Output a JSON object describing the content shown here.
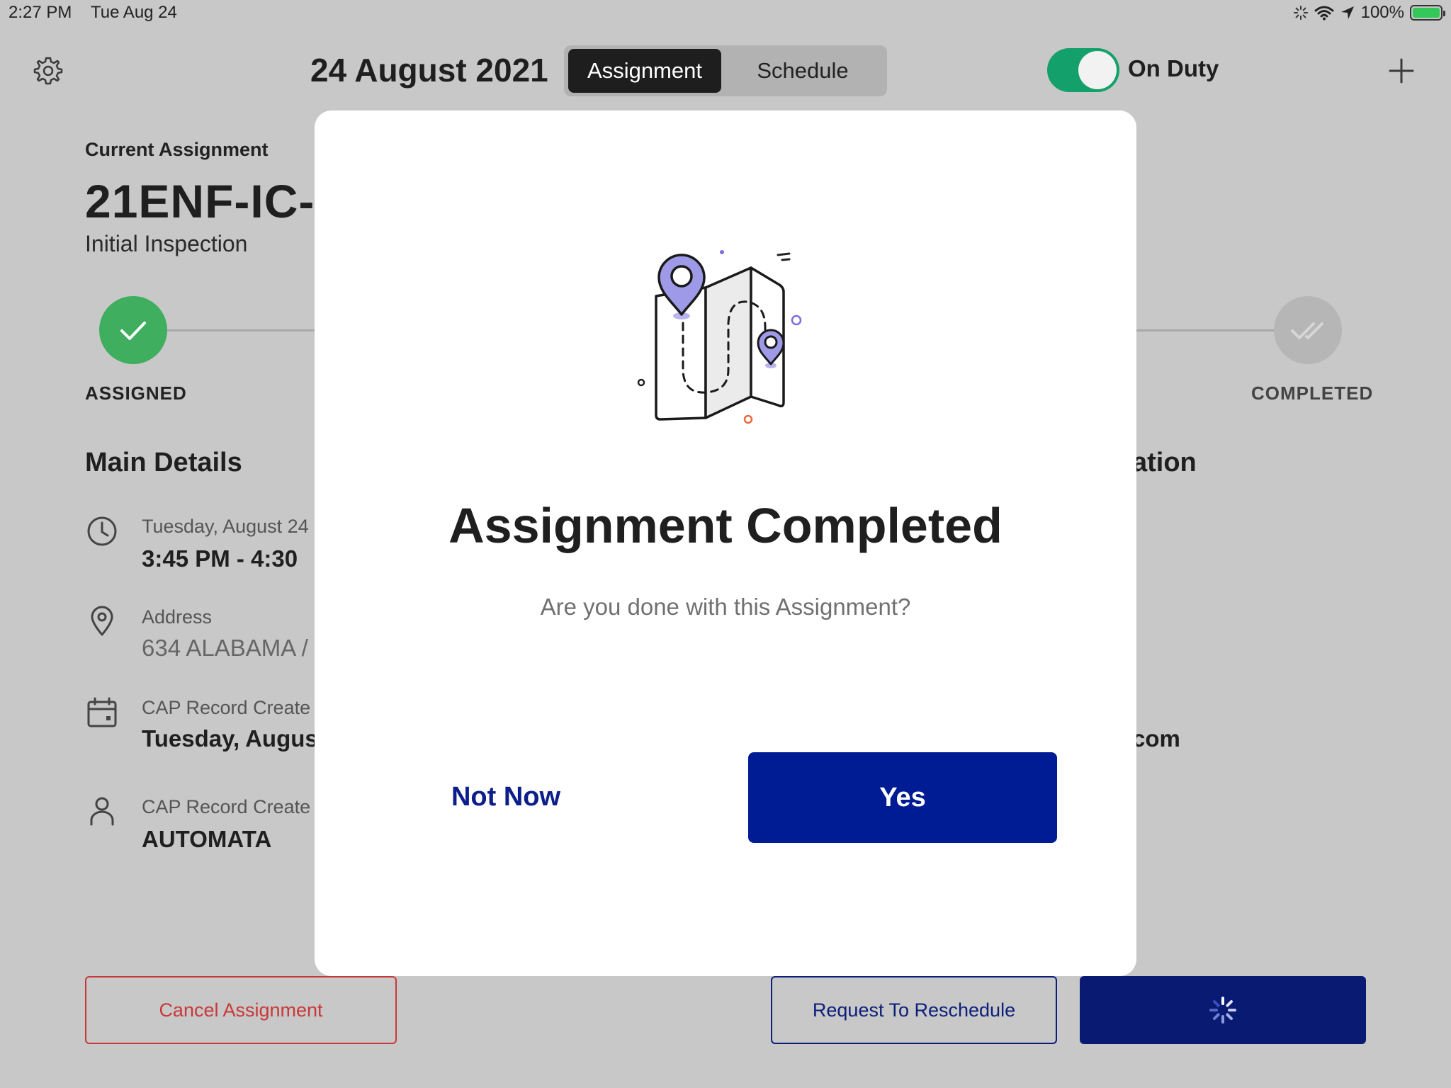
{
  "status_bar": {
    "time": "2:27 PM",
    "date": "Tue Aug 24",
    "battery": "100%"
  },
  "header": {
    "date": "24 August 2021",
    "tabs": [
      {
        "label": "Assignment",
        "selected": true
      },
      {
        "label": "Schedule",
        "selected": false
      }
    ],
    "duty_label": "On Duty",
    "duty_on": true
  },
  "assignment": {
    "section_label": "Current Assignment",
    "id": "21ENF-IC-(",
    "type": "Initial Inspection",
    "steps": [
      {
        "label": "ASSIGNED",
        "done": true
      },
      {
        "label": "COMPLETED",
        "done": false
      }
    ]
  },
  "details": {
    "heading": "Main Details",
    "right_heading": "ation",
    "right_value": "com",
    "items": [
      {
        "icon": "clock-icon",
        "label": "Tuesday, August 24",
        "value": "3:45 PM - 4:30"
      },
      {
        "icon": "location-pin-icon",
        "label": "Address",
        "value": "634 ALABAMA /"
      },
      {
        "icon": "calendar-icon",
        "label": "CAP Record Create",
        "value": "Tuesday, Augus"
      },
      {
        "icon": "person-icon",
        "label": "CAP Record Create",
        "value": "AUTOMATA"
      }
    ]
  },
  "bottom_buttons": {
    "cancel": "Cancel Assignment",
    "reschedule": "Request To Reschedule"
  },
  "modal": {
    "title": "Assignment Completed",
    "message": "Are you done with this Assignment?",
    "secondary": "Not Now",
    "primary": "Yes"
  },
  "colors": {
    "primary": "#001c94",
    "success": "#3fae5f",
    "danger": "#c93838",
    "toggle_on": "#14a06a",
    "illustration_accent": "#9f9ae8"
  }
}
